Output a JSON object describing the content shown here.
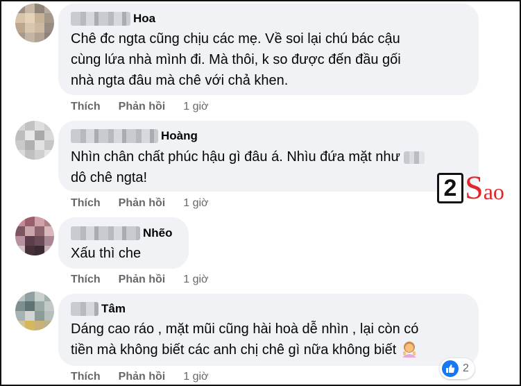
{
  "comments": [
    {
      "name": "Hoa",
      "lines": [
        "Chê đc ngta cũng chịu các mẹ. Về soi lại chú bác cậu",
        "cùng lứa nhà mình đi. Mà thôi, k so được đến đầu gối",
        "nhà ngta đâu mà chê với chả khen."
      ],
      "like": "Thích",
      "reply": "Phản hồi",
      "time": "1 giờ"
    },
    {
      "name": "Hoàng",
      "line1": "Nhìn chân chất phúc hậu gì đâu á. Nhìu đứa mặt như",
      "line2": "dô chê ngta!",
      "like": "Thích",
      "reply": "Phản hồi",
      "time": "1 giờ"
    },
    {
      "name": "Nhẽo",
      "lines": [
        "Xấu thì che"
      ],
      "like": "Thích",
      "reply": "Phản hồi",
      "time": "1 giờ"
    },
    {
      "name": "Tâm",
      "line1": "Dáng cao ráo , mặt mũi cũng hài hoà dễ nhìn , lại còn có",
      "line2": "tiền mà không biết các anh chị chê gì nữa không biết",
      "emoji": "woman-gesturing-icon",
      "like": "Thích",
      "reply": "Phản hồi",
      "time": "1 giờ",
      "reaction_count": "2",
      "reaction_icon": "like-icon"
    }
  ],
  "watermark": {
    "digit": "2",
    "s": "S",
    "rest": "ao"
  },
  "colors": {
    "bubble": "#f0f2f5",
    "secondary_text": "#65676b",
    "like_blue": "#1877f2",
    "brand_red": "#e0262b"
  }
}
